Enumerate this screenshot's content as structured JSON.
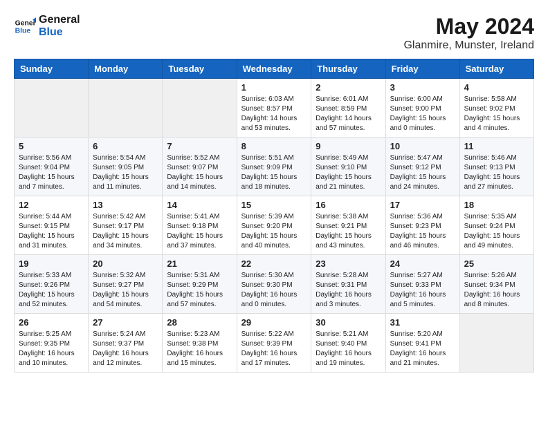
{
  "header": {
    "logo_line1": "General",
    "logo_line2": "Blue",
    "month": "May 2024",
    "location": "Glanmire, Munster, Ireland"
  },
  "weekdays": [
    "Sunday",
    "Monday",
    "Tuesday",
    "Wednesday",
    "Thursday",
    "Friday",
    "Saturday"
  ],
  "weeks": [
    [
      {
        "day": "",
        "detail": ""
      },
      {
        "day": "",
        "detail": ""
      },
      {
        "day": "",
        "detail": ""
      },
      {
        "day": "1",
        "detail": "Sunrise: 6:03 AM\nSunset: 8:57 PM\nDaylight: 14 hours\nand 53 minutes."
      },
      {
        "day": "2",
        "detail": "Sunrise: 6:01 AM\nSunset: 8:59 PM\nDaylight: 14 hours\nand 57 minutes."
      },
      {
        "day": "3",
        "detail": "Sunrise: 6:00 AM\nSunset: 9:00 PM\nDaylight: 15 hours\nand 0 minutes."
      },
      {
        "day": "4",
        "detail": "Sunrise: 5:58 AM\nSunset: 9:02 PM\nDaylight: 15 hours\nand 4 minutes."
      }
    ],
    [
      {
        "day": "5",
        "detail": "Sunrise: 5:56 AM\nSunset: 9:04 PM\nDaylight: 15 hours\nand 7 minutes."
      },
      {
        "day": "6",
        "detail": "Sunrise: 5:54 AM\nSunset: 9:05 PM\nDaylight: 15 hours\nand 11 minutes."
      },
      {
        "day": "7",
        "detail": "Sunrise: 5:52 AM\nSunset: 9:07 PM\nDaylight: 15 hours\nand 14 minutes."
      },
      {
        "day": "8",
        "detail": "Sunrise: 5:51 AM\nSunset: 9:09 PM\nDaylight: 15 hours\nand 18 minutes."
      },
      {
        "day": "9",
        "detail": "Sunrise: 5:49 AM\nSunset: 9:10 PM\nDaylight: 15 hours\nand 21 minutes."
      },
      {
        "day": "10",
        "detail": "Sunrise: 5:47 AM\nSunset: 9:12 PM\nDaylight: 15 hours\nand 24 minutes."
      },
      {
        "day": "11",
        "detail": "Sunrise: 5:46 AM\nSunset: 9:13 PM\nDaylight: 15 hours\nand 27 minutes."
      }
    ],
    [
      {
        "day": "12",
        "detail": "Sunrise: 5:44 AM\nSunset: 9:15 PM\nDaylight: 15 hours\nand 31 minutes."
      },
      {
        "day": "13",
        "detail": "Sunrise: 5:42 AM\nSunset: 9:17 PM\nDaylight: 15 hours\nand 34 minutes."
      },
      {
        "day": "14",
        "detail": "Sunrise: 5:41 AM\nSunset: 9:18 PM\nDaylight: 15 hours\nand 37 minutes."
      },
      {
        "day": "15",
        "detail": "Sunrise: 5:39 AM\nSunset: 9:20 PM\nDaylight: 15 hours\nand 40 minutes."
      },
      {
        "day": "16",
        "detail": "Sunrise: 5:38 AM\nSunset: 9:21 PM\nDaylight: 15 hours\nand 43 minutes."
      },
      {
        "day": "17",
        "detail": "Sunrise: 5:36 AM\nSunset: 9:23 PM\nDaylight: 15 hours\nand 46 minutes."
      },
      {
        "day": "18",
        "detail": "Sunrise: 5:35 AM\nSunset: 9:24 PM\nDaylight: 15 hours\nand 49 minutes."
      }
    ],
    [
      {
        "day": "19",
        "detail": "Sunrise: 5:33 AM\nSunset: 9:26 PM\nDaylight: 15 hours\nand 52 minutes."
      },
      {
        "day": "20",
        "detail": "Sunrise: 5:32 AM\nSunset: 9:27 PM\nDaylight: 15 hours\nand 54 minutes."
      },
      {
        "day": "21",
        "detail": "Sunrise: 5:31 AM\nSunset: 9:29 PM\nDaylight: 15 hours\nand 57 minutes."
      },
      {
        "day": "22",
        "detail": "Sunrise: 5:30 AM\nSunset: 9:30 PM\nDaylight: 16 hours\nand 0 minutes."
      },
      {
        "day": "23",
        "detail": "Sunrise: 5:28 AM\nSunset: 9:31 PM\nDaylight: 16 hours\nand 3 minutes."
      },
      {
        "day": "24",
        "detail": "Sunrise: 5:27 AM\nSunset: 9:33 PM\nDaylight: 16 hours\nand 5 minutes."
      },
      {
        "day": "25",
        "detail": "Sunrise: 5:26 AM\nSunset: 9:34 PM\nDaylight: 16 hours\nand 8 minutes."
      }
    ],
    [
      {
        "day": "26",
        "detail": "Sunrise: 5:25 AM\nSunset: 9:35 PM\nDaylight: 16 hours\nand 10 minutes."
      },
      {
        "day": "27",
        "detail": "Sunrise: 5:24 AM\nSunset: 9:37 PM\nDaylight: 16 hours\nand 12 minutes."
      },
      {
        "day": "28",
        "detail": "Sunrise: 5:23 AM\nSunset: 9:38 PM\nDaylight: 16 hours\nand 15 minutes."
      },
      {
        "day": "29",
        "detail": "Sunrise: 5:22 AM\nSunset: 9:39 PM\nDaylight: 16 hours\nand 17 minutes."
      },
      {
        "day": "30",
        "detail": "Sunrise: 5:21 AM\nSunset: 9:40 PM\nDaylight: 16 hours\nand 19 minutes."
      },
      {
        "day": "31",
        "detail": "Sunrise: 5:20 AM\nSunset: 9:41 PM\nDaylight: 16 hours\nand 21 minutes."
      },
      {
        "day": "",
        "detail": ""
      }
    ]
  ]
}
